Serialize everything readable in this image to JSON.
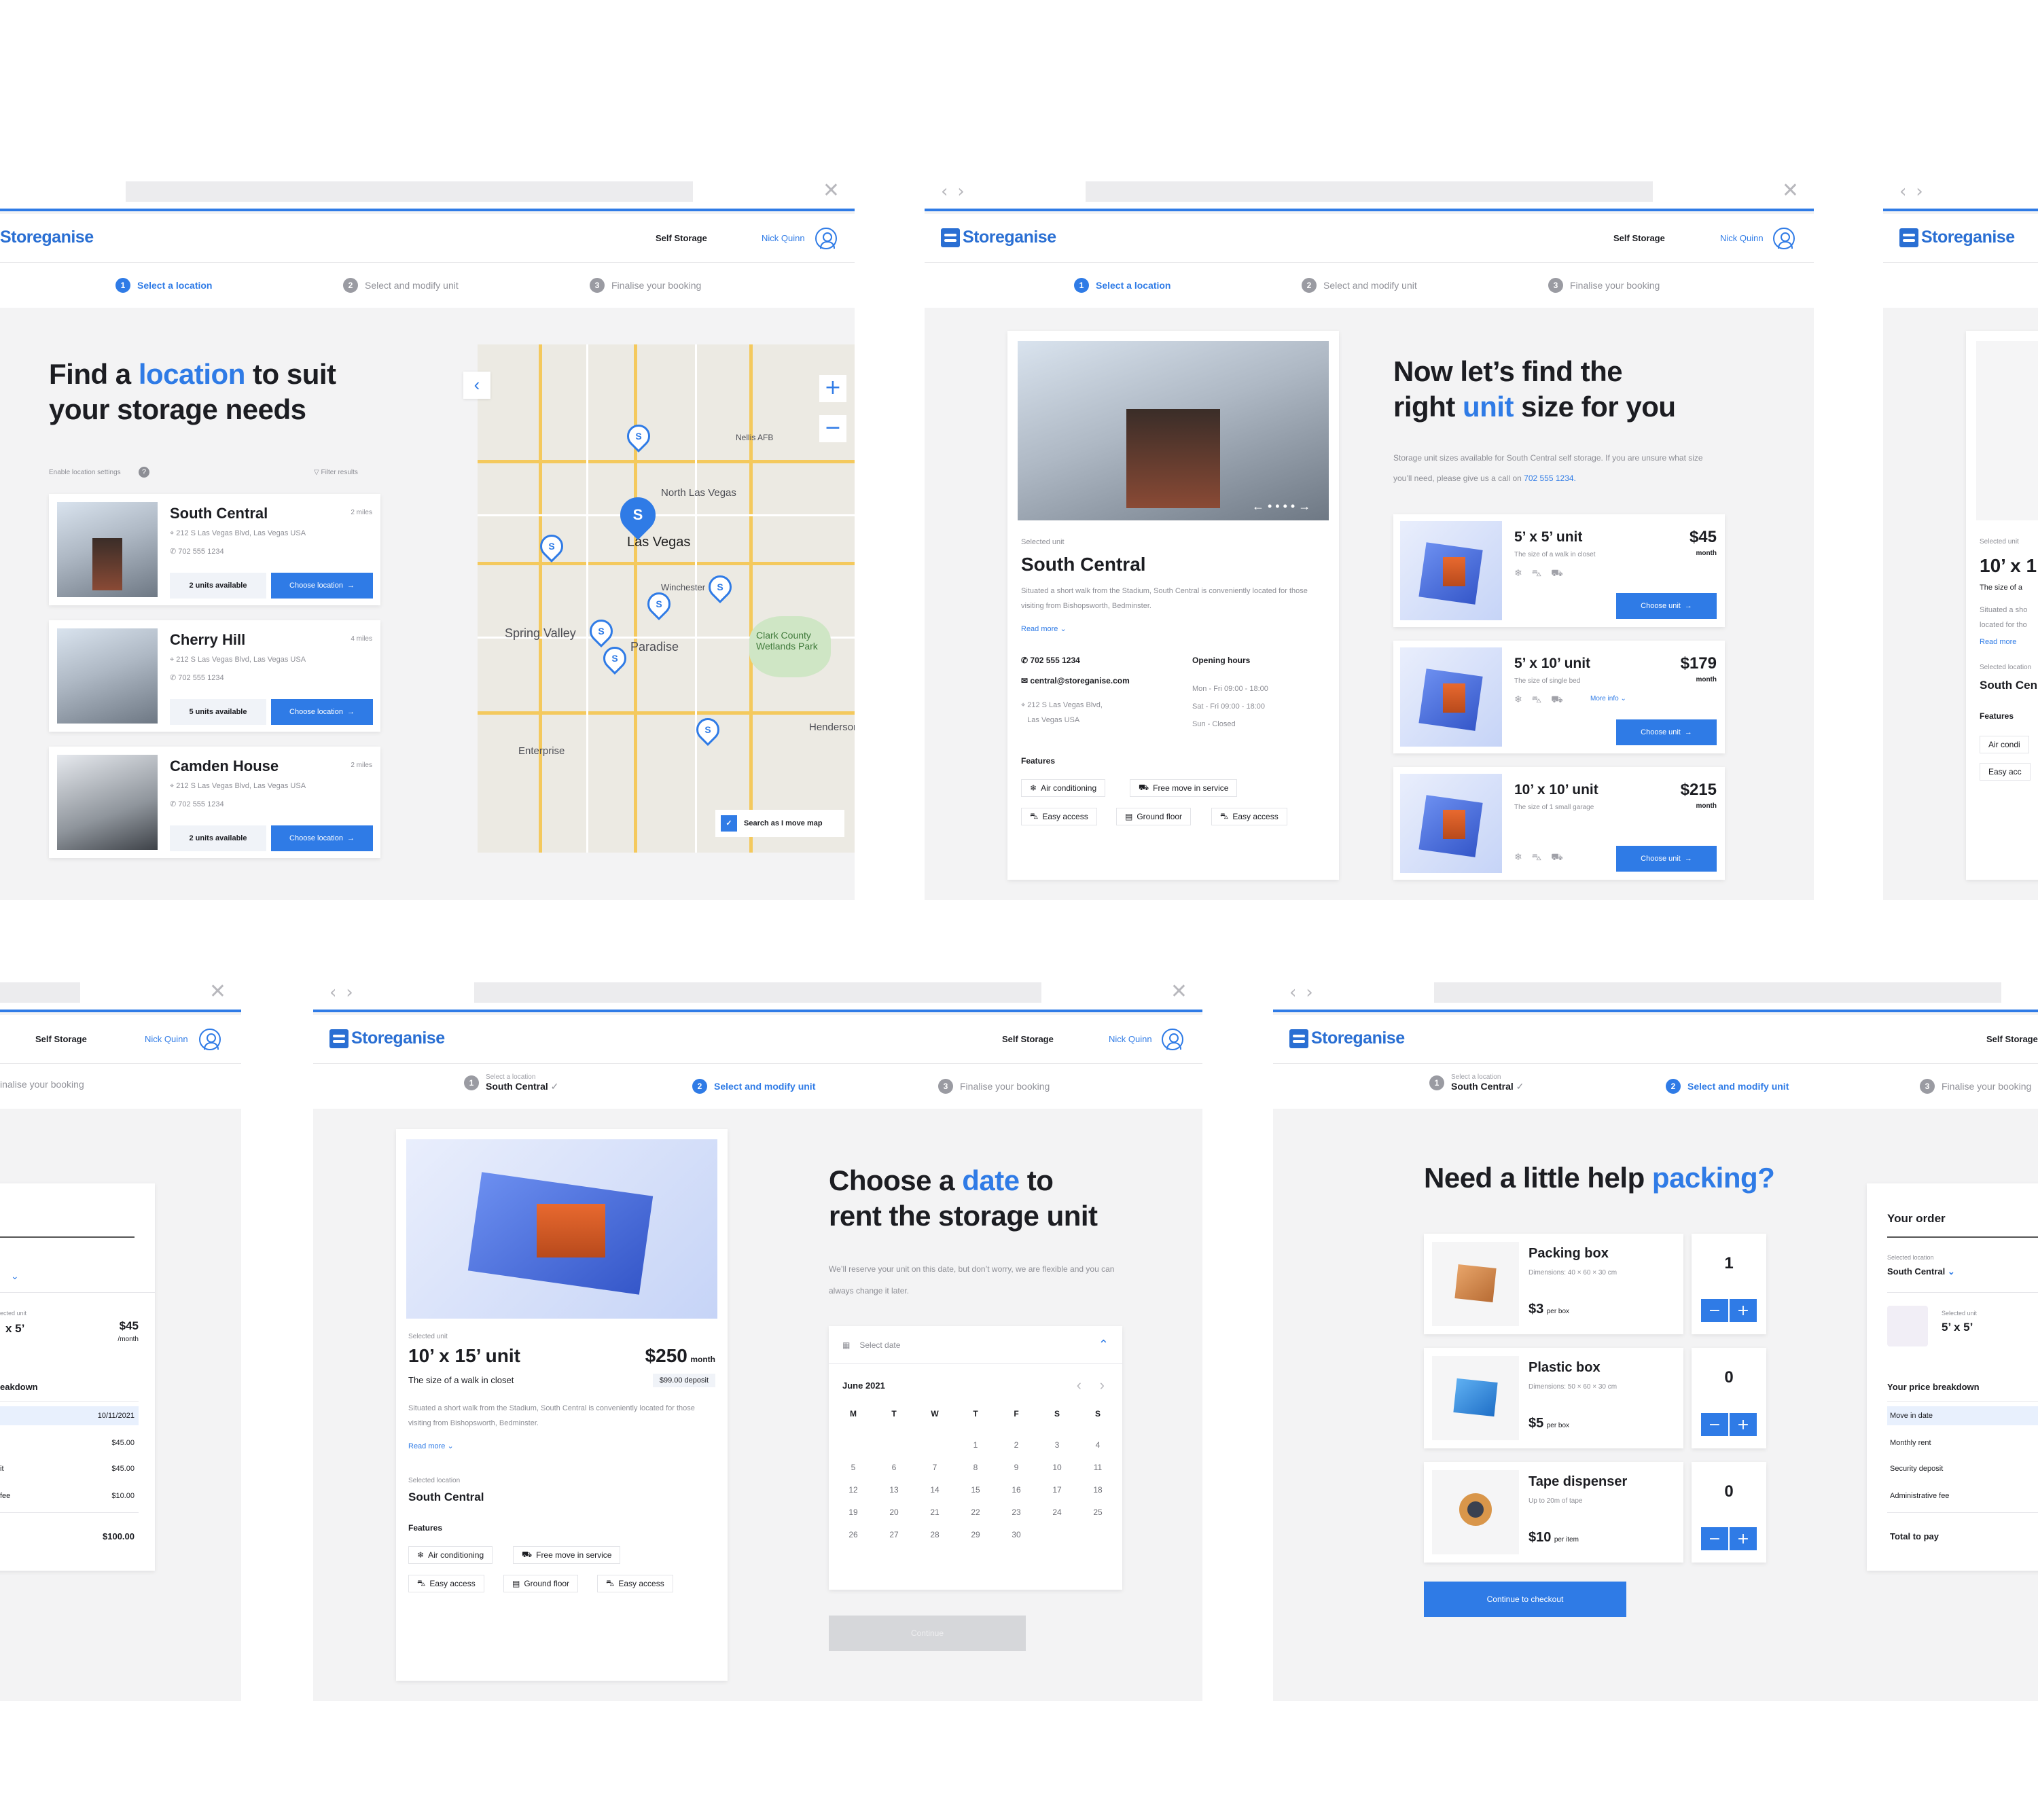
{
  "app": {
    "logo": "Storeganise",
    "service": "Self Storage",
    "user": "Nick Quinn"
  },
  "steps": {
    "one": "Select a location",
    "two": "Select and modify unit",
    "three": "Finalise your booking",
    "selected_caption": "Select a location",
    "selected_location": "South Central"
  },
  "s1": {
    "title_pre": "Find a ",
    "title_hl": "location",
    "title_post": " to suit",
    "title_line2": "your storage needs",
    "enable": "Enable location settings",
    "filter": "Filter results",
    "locations": [
      {
        "name": "South Central",
        "dist": "2 miles",
        "addr": "212 S Las Vegas Blvd, Las Vegas USA",
        "phone": "702 555 1234",
        "avail": "2 units available",
        "cta": "Choose location"
      },
      {
        "name": "Cherry Hill",
        "dist": "4 miles",
        "addr": "212 S Las Vegas Blvd, Las Vegas USA",
        "phone": "702 555 1234",
        "avail": "5 units available",
        "cta": "Choose location"
      },
      {
        "name": "Camden House",
        "dist": "2 miles",
        "addr": "212 S Las Vegas Blvd, Las Vegas USA",
        "phone": "702 555 1234",
        "avail": "2 units available",
        "cta": "Choose location"
      }
    ],
    "map": {
      "labels": [
        "Las Vegas",
        "North Las Vegas",
        "Spring Valley",
        "Paradise",
        "Enterprise",
        "Nellis AFB",
        "Clark County Wetlands Park",
        "Henderson",
        "Winchester"
      ],
      "search_toggle": "Search as I move map",
      "pin": "S"
    }
  },
  "s2": {
    "title_line1": "Now let’s find the",
    "title_pre": "right ",
    "title_hl": "unit",
    "title_post": " size for you",
    "intro": "Storage unit sizes available for South Central self storage. If you are unsure what size you’ll need, please give us a call on",
    "intro_phone": "702 555 1234.",
    "caption": "Selected unit",
    "name": "South Central",
    "desc": "Situated a short walk from the Stadium, South Central is conveniently located for those visiting from Bishopsworth, Bedminster.",
    "read_more": "Read more",
    "phone": "702 555 1234",
    "email": "central@storeganise.com",
    "addr1": "212 S Las Vegas Blvd,",
    "addr2": "Las Vegas USA",
    "hours_title": "Opening hours",
    "hours": [
      "Mon - Fri 09:00 - 18:00",
      "Sat - Fri 09:00 - 18:00",
      "Sun - Closed"
    ],
    "features_title": "Features",
    "features": [
      "Air conditioning",
      "Free move in service",
      "Easy access",
      "Ground floor",
      "Easy access"
    ],
    "units": [
      {
        "name": "5’ x 5’ unit",
        "sub": "The size of a walk in closet",
        "price": "$45",
        "per": "month",
        "cta": "Choose unit"
      },
      {
        "name": "5’ x 10’ unit",
        "sub": "The size of single bed",
        "price": "$179",
        "per": "month",
        "cta": "Choose unit",
        "more": "More info"
      },
      {
        "name": "10’ x 10’ unit",
        "sub": "The size of 1 small garage",
        "price": "$215",
        "per": "month",
        "cta": "Choose unit"
      }
    ]
  },
  "s3": {
    "caption": "Selected unit",
    "unit": "10’ x 1",
    "sub": "The size of a",
    "situated1": "Situated a sho",
    "situated2": "located for tho",
    "read_more": "Read more",
    "loc_caption": "Selected location",
    "loc": "South Cen",
    "features": "Features",
    "f1": "Air condi",
    "f2": "Easy acc"
  },
  "s4": {
    "rows": [
      "10/11/2021",
      "$45.00",
      "$45.00",
      "$10.00"
    ],
    "row_labels": [
      "it",
      "fee"
    ],
    "total": "$100.00",
    "unit": "x 5’",
    "price": "$45",
    "per": "/month",
    "heading": "eakdown",
    "cap": "ected unit",
    "step_tail": "inalise your booking"
  },
  "s5": {
    "title_pre": "Choose a ",
    "title_hl": "date",
    "title_post": " to",
    "title_line2": "rent the storage unit",
    "intro": "We’ll reserve your unit on this date, but don’t worry, we are flexible and you can always change it later.",
    "caption": "Selected unit",
    "unit": "10’ x 15’ unit",
    "price": "$250",
    "per": "month",
    "deposit": "$99.00 deposit",
    "sub": "The size of a walk in closet",
    "desc": "Situated a short walk from the Stadium, South Central is conveniently located for those visiting from Bishopsworth, Bedminster.",
    "read_more": "Read more",
    "loc_caption": "Selected location",
    "loc": "South Central",
    "features_title": "Features",
    "features": [
      "Air conditioning",
      "Free move in service",
      "Easy access",
      "Ground floor",
      "Easy access"
    ],
    "select_date": "Select date",
    "month": "June 2021",
    "dow": [
      "M",
      "T",
      "W",
      "T",
      "F",
      "S",
      "S"
    ],
    "days": [
      "",
      "",
      "",
      "1",
      "2",
      "3",
      "4",
      "5",
      "6",
      "7",
      "8",
      "9",
      "10",
      "11",
      "12",
      "13",
      "14",
      "15",
      "16",
      "17",
      "18",
      "19",
      "20",
      "21",
      "22",
      "23",
      "24",
      "25",
      "26",
      "27",
      "28",
      "29",
      "30",
      "",
      ""
    ],
    "continue": "Continue"
  },
  "s6": {
    "title_pre": "Need a little help ",
    "title_hl": "packing?",
    "items": [
      {
        "name": "Packing box",
        "dims": "Dimensions: 40 × 60 × 30 cm",
        "price": "$3",
        "per": "per box",
        "qty": "1"
      },
      {
        "name": "Plastic box",
        "dims": "Dimensions: 50 × 60 × 30 cm",
        "price": "$5",
        "per": "per box",
        "qty": "0"
      },
      {
        "name": "Tape dispenser",
        "dims": "Up to 20m of tape",
        "price": "$10",
        "per": "per item",
        "qty": "0"
      }
    ],
    "checkout": "Continue to checkout",
    "order": {
      "title": "Your order",
      "loc_caption": "Selected location",
      "loc": "South Central",
      "unit_caption": "Selected unit",
      "unit": "5’ x 5’",
      "breakdown": "Your price breakdown",
      "rows": [
        "Move in date",
        "Monthly rent",
        "Security deposit",
        "Administrative fee"
      ],
      "total": "Total to pay"
    }
  },
  "colors": {
    "accent": "#2f7be6",
    "bg": "#f3f3f4"
  }
}
